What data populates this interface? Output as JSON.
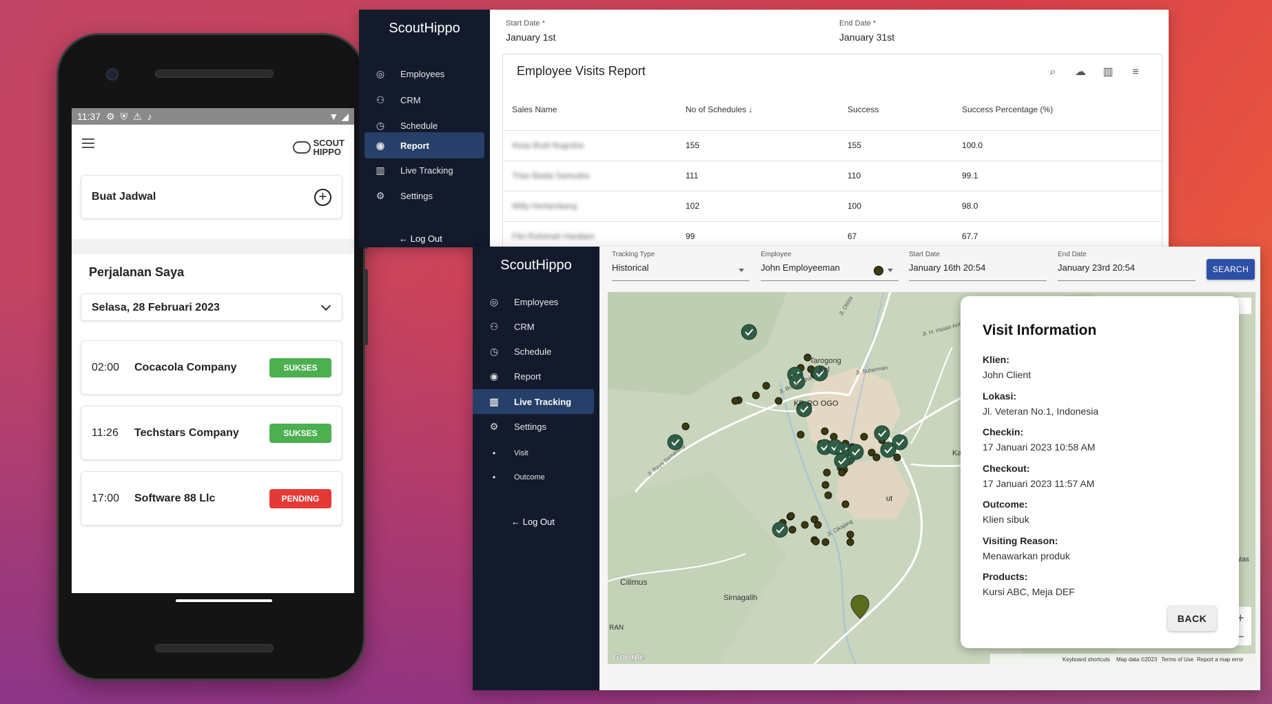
{
  "mobile": {
    "status_time": "11:37",
    "brand_line1": "SCOUT",
    "brand_line2": "HIPPO",
    "create_schedule_label": "Buat Jadwal",
    "section_title": "Perjalanan Saya",
    "selected_date": "Selasa, 28 Februari 2023",
    "trips": [
      {
        "time": "02:00",
        "company": "Cocacola Company",
        "status": "SUKSES",
        "status_color": "#4caf50"
      },
      {
        "time": "11:26",
        "company": "Techstars Company",
        "status": "SUKSES",
        "status_color": "#4caf50"
      },
      {
        "time": "17:00",
        "company": "Software 88 Llc",
        "status": "PENDING",
        "status_color": "#e53935"
      }
    ]
  },
  "report_panel": {
    "brand": "ScoutHippo",
    "nav": [
      {
        "label": "Employees",
        "icon": "account-circle-icon"
      },
      {
        "label": "CRM",
        "icon": "people-icon"
      },
      {
        "label": "Schedule",
        "icon": "timer-icon"
      },
      {
        "label": "Report",
        "icon": "eye-icon"
      },
      {
        "label": "Live Tracking",
        "icon": "map-icon"
      },
      {
        "label": "Settings",
        "icon": "gear-icon"
      }
    ],
    "active_nav": "Report",
    "logout_label": "Log Out",
    "start_date_label": "Start Date *",
    "start_date": "January 1st",
    "end_date_label": "End Date *",
    "end_date": "January 31st",
    "report_title": "Employee Visits Report",
    "toolbar_icons": [
      "search-icon",
      "cloud-download-icon",
      "view-column-icon",
      "filter-icon"
    ],
    "columns": [
      "Sales Name",
      "No of Schedules",
      "Success",
      "Success Percentage (%)"
    ],
    "rows": [
      {
        "name": "Asep Budi Nugraha",
        "schedules": "155",
        "success": "155",
        "percentage": "100.0"
      },
      {
        "name": "Trias Badai Samudra",
        "schedules": "111",
        "success": "110",
        "percentage": "99.1"
      },
      {
        "name": "Willy Herlambang",
        "schedules": "102",
        "success": "100",
        "percentage": "98.0"
      },
      {
        "name": "Fitri Rohimah Hardiani",
        "schedules": "99",
        "success": "67",
        "percentage": "67.7"
      }
    ]
  },
  "tracking_panel": {
    "brand": "ScoutHippo",
    "nav": [
      {
        "label": "Employees",
        "icon": "account-circle-icon"
      },
      {
        "label": "CRM",
        "icon": "people-icon"
      },
      {
        "label": "Schedule",
        "icon": "timer-icon"
      },
      {
        "label": "Report",
        "icon": "eye-icon"
      },
      {
        "label": "Live Tracking",
        "icon": "map-icon"
      },
      {
        "label": "Settings",
        "icon": "gear-icon"
      }
    ],
    "sub_nav": [
      "Visit",
      "Outcome"
    ],
    "active_nav": "Live Tracking",
    "logout_label": "Log Out",
    "tracking_type_label": "Tracking Type",
    "tracking_type": "Historical",
    "employee_label": "Employee",
    "employee": "John Employeeman",
    "start_date_label": "Start Date",
    "start_date": "January 16th 20:54",
    "end_date_label": "End Date",
    "end_date": "January 23rd 20:54",
    "search_label": "SEARCH",
    "map_labels": {
      "tarogong": "Tarogong",
      "kaler": "Kal",
      "kp_rogo": "KP. RO OGO",
      "cilimus": "Cilimus",
      "sirnagalih": "Sirnagalih",
      "ran": "RAN",
      "ka": "Ka",
      "ut": "ut",
      "road_hasan": "Jl. H. Hasan Arif",
      "road_raya": "Jl. Raya Samarang",
      "road_bratayuda": "Jl. Bratayudha",
      "road_otista": "Jl. Otista",
      "road_suherman": "Jl. Suherman",
      "road_cikajang": "Jl. Cikajang",
      "google": "Google",
      "keyboard": "Keyboard shortcuts",
      "mapdata": "Map data ©2023",
      "terms": "Terms of Use",
      "report_error": "Report a map error",
      "tas": "ntas",
      "zoom_in": "+",
      "zoom_out": "−"
    },
    "marker_color": "#2f5d46",
    "dot_color": "#3b3b0e"
  },
  "visit_info": {
    "title": "Visit Information",
    "fields": [
      {
        "key": "Klien:",
        "value": "John Client"
      },
      {
        "key": "Lokasi:",
        "value": "Jl. Veteran No.1, Indonesia"
      },
      {
        "key": "Checkin:",
        "value": "17 Januari 2023 10:58 AM"
      },
      {
        "key": "Checkout:",
        "value": "17 Januari 2023 11:57 AM"
      },
      {
        "key": "Outcome:",
        "value": "Klien sibuk"
      },
      {
        "key": "Visiting Reason:",
        "value": "Menawarkan produk"
      },
      {
        "key": "Products:",
        "value": "Kursi ABC, Meja DEF"
      }
    ],
    "back_label": "BACK"
  }
}
